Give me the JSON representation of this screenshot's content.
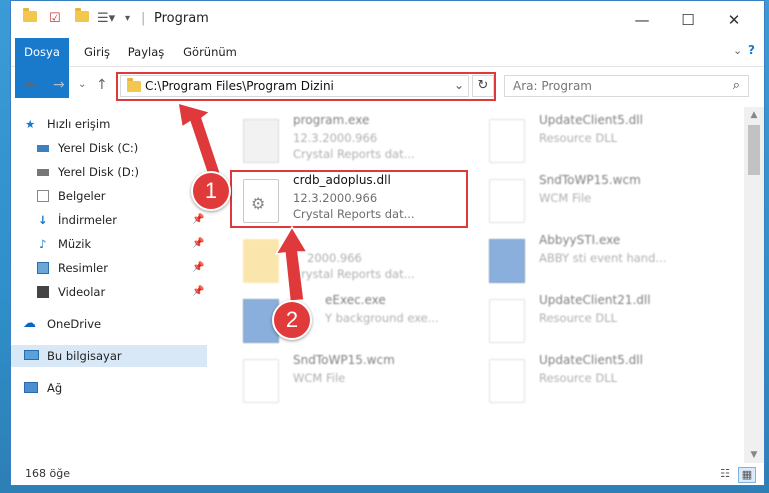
{
  "window": {
    "title": "Program",
    "quick_access_icons": [
      "folder-icon",
      "checkbox-icon",
      "folder-icon",
      "properties-icon"
    ],
    "controls": [
      "minimize-icon",
      "maximize-icon",
      "close-icon"
    ]
  },
  "ribbon": {
    "tabs": [
      "Dosya",
      "Giriş",
      "Paylaş",
      "Görünüm"
    ]
  },
  "address": {
    "path": "C:\\Program Files\\Program Dizini",
    "search_placeholder": "Ara: Program"
  },
  "nav": {
    "items": [
      {
        "label": "Hızlı erişim",
        "icon": "star-icon",
        "pinned": false
      },
      {
        "label": "Yerel Disk (C:)",
        "icon": "drive-icon",
        "pinned": false
      },
      {
        "label": "Yerel Disk (D:)",
        "icon": "drive-icon",
        "pinned": false
      },
      {
        "label": "Belgeler",
        "icon": "documents-icon",
        "pinned": true
      },
      {
        "label": "İndirmeler",
        "icon": "download-icon",
        "pinned": true
      },
      {
        "label": "Müzik",
        "icon": "music-icon",
        "pinned": true
      },
      {
        "label": "Resimler",
        "icon": "pictures-icon",
        "pinned": true
      },
      {
        "label": "Videolar",
        "icon": "video-icon",
        "pinned": true
      },
      {
        "label": "OneDrive",
        "icon": "cloud-icon",
        "pinned": false
      },
      {
        "label": "Bu bilgisayar",
        "icon": "computer-icon",
        "pinned": false,
        "selected": true
      },
      {
        "label": "Ağ",
        "icon": "network-icon",
        "pinned": false
      }
    ]
  },
  "files": {
    "left": [
      {
        "name": "program.exe",
        "line2": "12.3.2000.966",
        "line3": "Crystal Reports dat..."
      },
      {
        "name": "crdb_adoplus.dll",
        "line2": "12.3.2000.966",
        "line3": "Crystal Reports dat..."
      },
      {
        "name": "",
        "line2": "2000.966",
        "line3": "Crystal Reports dat..."
      },
      {
        "name": "eExec.exe",
        "line2": "Y background exe...",
        "line3": ""
      },
      {
        "name": "SndToWP15.wcm",
        "line2": "WCM File",
        "line3": ""
      }
    ],
    "right": [
      {
        "name": "UpdateClient5.dll",
        "line2": "Resource DLL"
      },
      {
        "name": "SndToWP15.wcm",
        "line2": "WCM File"
      },
      {
        "name": "AbbyySTI.exe",
        "line2": "ABBY sti event hand..."
      },
      {
        "name": "UpdateClient21.dll",
        "line2": "Resource DLL"
      },
      {
        "name": "UpdateClient5.dll",
        "line2": "Resource DLL"
      }
    ]
  },
  "status": {
    "count": "168 öğe"
  },
  "annotations": {
    "step1": "1",
    "step2": "2",
    "color": "#e0393b"
  }
}
